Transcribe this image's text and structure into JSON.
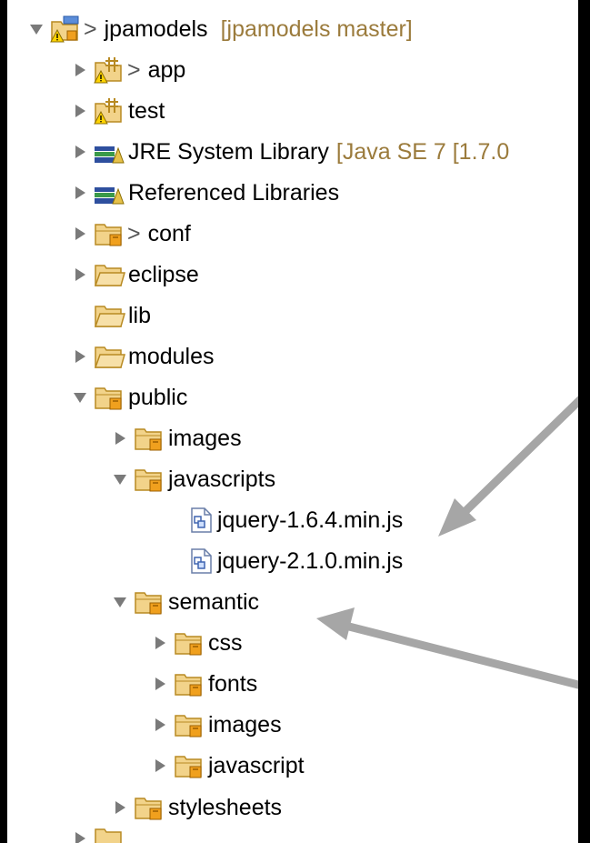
{
  "tree": {
    "project": {
      "prefix": ">",
      "label": "jpamodels",
      "decoration": "[jpamodels master]"
    },
    "items": [
      {
        "prefix": ">",
        "label": "app"
      },
      {
        "label": "test"
      },
      {
        "label": "JRE System Library",
        "decoration": "[Java SE 7 [1.7.0"
      },
      {
        "label": "Referenced Libraries"
      },
      {
        "prefix": ">",
        "label": "conf"
      },
      {
        "label": "eclipse"
      },
      {
        "label": "lib"
      },
      {
        "label": "modules"
      },
      {
        "label": "public"
      },
      {
        "label": "images"
      },
      {
        "label": "javascripts"
      },
      {
        "label": "jquery-1.6.4.min.js"
      },
      {
        "label": "jquery-2.1.0.min.js"
      },
      {
        "label": "semantic"
      },
      {
        "label": "css"
      },
      {
        "label": "fonts"
      },
      {
        "label": "images"
      },
      {
        "label": "javascript"
      },
      {
        "label": "stylesheets"
      }
    ]
  },
  "icons": {
    "expanded": "triangle-down-icon",
    "collapsed": "triangle-right-icon",
    "project": "project-warning-icon",
    "package": "package-warning-icon",
    "library": "library-icon",
    "folder": "folder-icon",
    "package_folder": "package-folder-icon",
    "js_file": "javascript-file-icon"
  },
  "colors": {
    "decoration": "#9b7b3c",
    "arrow": "#a6a6a6",
    "folder_fill": "#f2d38a",
    "folder_stroke": "#b88a22",
    "package_badge": "#f0a01e"
  }
}
